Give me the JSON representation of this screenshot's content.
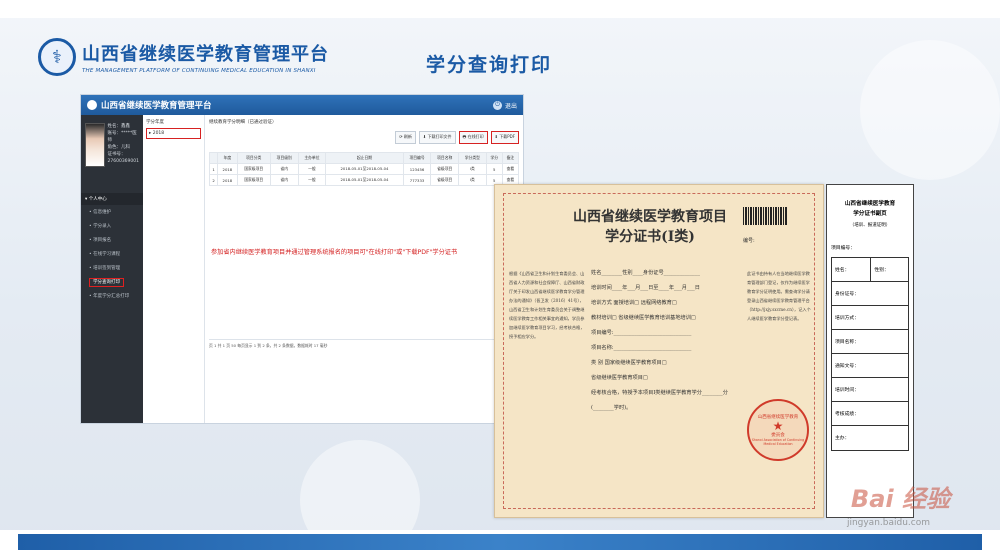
{
  "brand": {
    "title": "山西省继续医学教育管理平台",
    "subtitle": "THE MANAGEMENT PLATFORM OF CONTINUING MEDICAL EDUCATION IN SHANXI"
  },
  "slide_title": "学分查询打印",
  "app": {
    "title": "山西省继续医学教育管理平台",
    "exit_label": "退出",
    "user": {
      "name_label": "姓名：鑫鑫",
      "account_label": "账号：*****医师",
      "role_label": "角色：儿科",
      "cert_label": "证书号：",
      "cert_value": "27600369001"
    },
    "sidebar": {
      "section": "个人中心",
      "items": [
        "信息维护",
        "学分录入",
        "项目报名",
        "在线学习课程",
        "培训签到管理",
        "学分查询打印",
        "年度学分汇总打印"
      ]
    },
    "year_col": {
      "header": "学分年度",
      "selected": "2018"
    },
    "breadcrumb": "继续教育学分明细（已通过验证）",
    "toolbar": [
      "刷新",
      "下载打印文件",
      "在线打印",
      "下载PDF"
    ],
    "table": {
      "headers": [
        "",
        "年度",
        "项目分类",
        "项目级别",
        "主办单位",
        "起止日期",
        "项目编号",
        "项目名称",
        "学分类型",
        "学分",
        "备注"
      ],
      "rows": [
        [
          "1",
          "2018",
          "国家级项目",
          "省内",
          "一般",
          "2018-05-01至2018-05-04",
          "123456",
          "省级项目",
          "I类",
          "5",
          "查看"
        ],
        [
          "2",
          "2018",
          "国家级项目",
          "省内",
          "一般",
          "2018-05-01至2018-05-04",
          "777333",
          "省级项目",
          "I类",
          "5",
          "查看"
        ]
      ]
    },
    "note": "参加省内继续医学教育项目并通过管理系统报名的项目可\"在线打印\"或\"下载PDF\"学分证书",
    "pager": "页   1   共 1 页   50   每页显示 1 到 2 条，共 2 条数据，数据耗时 17 毫秒"
  },
  "certificate": {
    "title_line1": "山西省继续医学教育项目",
    "title_line2": "学分证书(I类)",
    "number_label": "编号:",
    "left_text": "根据《山西省卫生和计划生育委员会、山西省人力资源和社会保障厅、山西省财政厅关于印发山西省继续医学教育学分管理办法的通知》（晋卫发〔2016〕41号），山西省卫生和计划生育委员会关于调整继续医学教育工作相关事宜的通知，学员参加继续医学教育项目学习，经考核合格，授予相应学分。",
    "fields": [
      "姓名________性别____身份证号______________",
      "培训时间____年___月___日至____年___月___日",
      "培训方式  面授培训□        远程网络教育□",
      "教材培训□  省级继续医学教育培训基地培训□",
      "项目编号:______________________________",
      "项目名称:______________________________",
      "类    别  国家级继续医学教育项目□",
      "          省级继续医学教育项目□",
      "经考核合格，特授予本项目I类继续医学教育学分________分",
      "(________学时)。"
    ],
    "right_text": "此证书由持有人在当地继续医学教育管理部门登记，仅作为继续医学教育学分证明使用。需查询学分请登录山西省继续医学教育管理平台（http://jxjy.sxcme.cn），记入个人继续医学教育学分登记表。",
    "seal_line1": "山西省继续医学教育",
    "seal_line2": "委员会",
    "seal_en": "Shanxi Association of Continuing Medical Education"
  },
  "stub": {
    "title_line1": "山西省继续医学教育",
    "title_line2": "学分证书副页",
    "subtitle": "（培训、报道证明）",
    "project_no_label": "项目编号：",
    "rows": [
      [
        "姓名：",
        "性别："
      ],
      [
        "身份证号：",
        ""
      ],
      [
        "培训方式：",
        ""
      ],
      [
        "项目名称：",
        ""
      ],
      [
        "通知文号：",
        ""
      ],
      [
        "培训时间：",
        ""
      ],
      [
        "考核成绩：",
        ""
      ],
      [
        "主办：",
        ""
      ]
    ]
  },
  "watermark": {
    "text": "Bai 经验",
    "url": "jingyan.baidu.com"
  }
}
